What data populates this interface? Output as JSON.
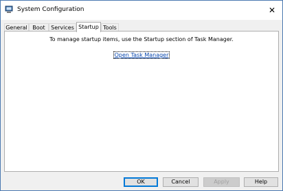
{
  "window": {
    "title": "System Configuration",
    "close_glyph": "✕",
    "icon": "app-icon"
  },
  "tabs": [
    {
      "label": "General",
      "active": false
    },
    {
      "label": "Boot",
      "active": false
    },
    {
      "label": "Services",
      "active": false
    },
    {
      "label": "Startup",
      "active": true
    },
    {
      "label": "Tools",
      "active": false
    }
  ],
  "startup": {
    "info_text": "To manage startup items, use the Startup section of Task Manager.",
    "link_text": "Open Task Manager"
  },
  "buttons": {
    "ok": "OK",
    "cancel": "Cancel",
    "apply": "Apply",
    "help": "Help"
  },
  "colors": {
    "border": "#4a78b0",
    "link": "#0645ad",
    "accent": "#0078d7"
  }
}
